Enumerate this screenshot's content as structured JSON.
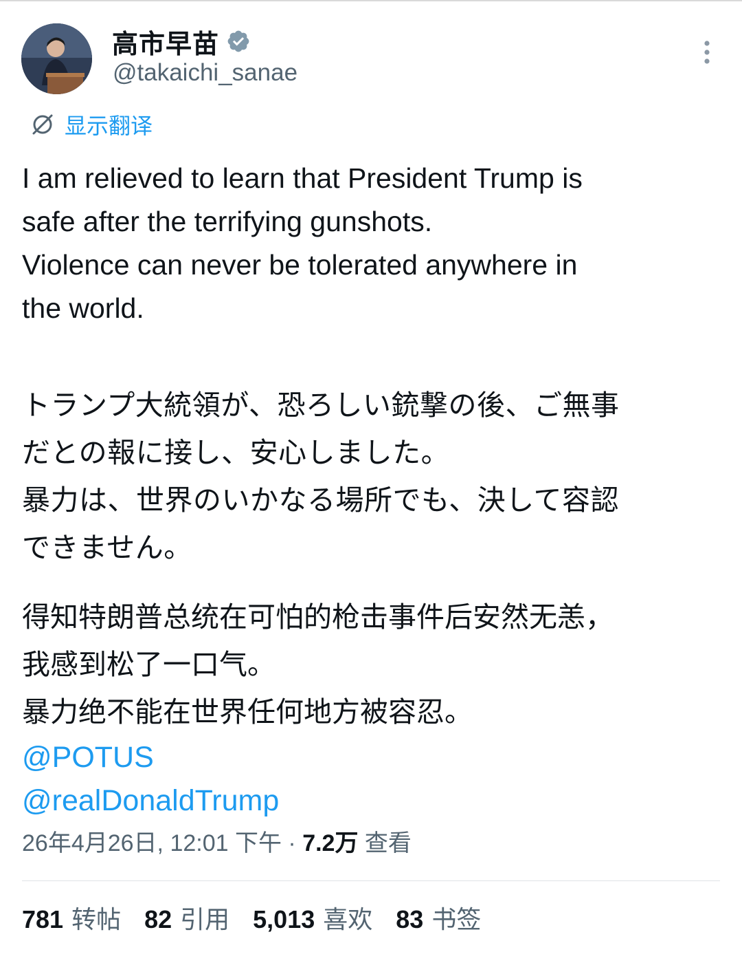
{
  "author": {
    "display_name": "高市早苗",
    "handle": "@takaichi_sanae"
  },
  "icons": {
    "avatar": "profile-photo",
    "verified": "verified-badge-icon",
    "more": "vertical-ellipsis-icon",
    "translate": "translate-icon"
  },
  "translate_label": "显示翻译",
  "tweet": {
    "en_lines": [
      "I am relieved to learn that President Trump is",
      "safe after the terrifying gunshots.",
      "Violence can never be tolerated anywhere in",
      "the world."
    ],
    "jp_lines": [
      "トランプ大統領が、恐ろしい銃撃の後、ご無事",
      "だとの報に接し、安心しました。",
      "暴力は、世界のいかなる場所でも、決して容認",
      "できません。"
    ],
    "zh_lines": [
      "得知特朗普总统在可怕的枪击事件后安然无恙，",
      "我感到松了一口气。",
      "暴力绝不能在世界任何地方被容忍。"
    ],
    "mentions": [
      "@POTUS",
      "@realDonaldTrump"
    ]
  },
  "meta": {
    "timestamp": "26年4月26日, 12:01 下午",
    "separator": " · ",
    "views_count": "7.2万",
    "views_label": "查看"
  },
  "stats": [
    {
      "count": "781",
      "label": "转帖"
    },
    {
      "count": "82",
      "label": "引用"
    },
    {
      "count": "5,013",
      "label": "喜欢"
    },
    {
      "count": "83",
      "label": "书签"
    }
  ],
  "colors": {
    "link": "#1d9bf0",
    "secondary_text": "#536471",
    "primary_text": "#0f1419",
    "verified_badge": "#829aab"
  }
}
